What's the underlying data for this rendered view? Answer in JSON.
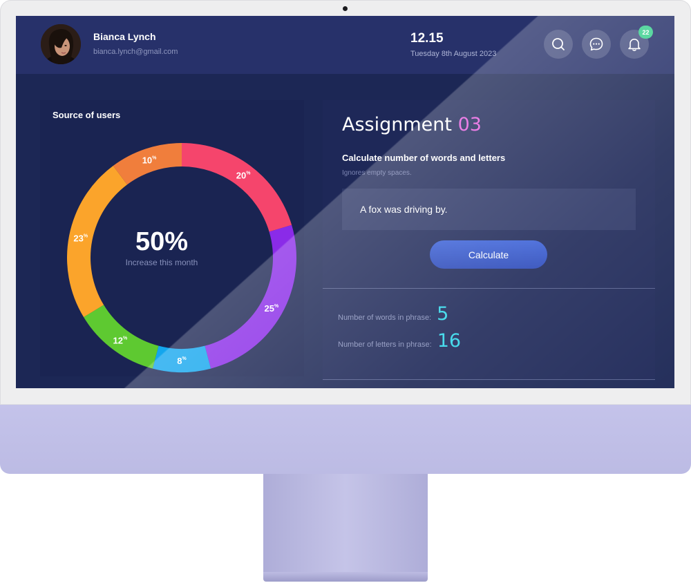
{
  "user": {
    "name": "Bianca Lynch",
    "email": "bianca.lynch@gmail.com"
  },
  "clock": {
    "time": "12.15",
    "date": "Tuesday 8th August 2023"
  },
  "notifications": {
    "count": "22"
  },
  "source_panel": {
    "title": "Source of users",
    "center_value": "50%",
    "center_label": "Increase this month"
  },
  "chart_data": {
    "type": "pie",
    "title": "Source of users",
    "slices": [
      {
        "value": 20,
        "label": "20",
        "color": "#f5456c"
      },
      {
        "value": 25,
        "label": "25",
        "color": "#8a2be8"
      },
      {
        "value": 8,
        "label": "8",
        "color": "#13a6ee"
      },
      {
        "value": 12,
        "label": "12",
        "color": "#5ec931"
      },
      {
        "value": 23,
        "label": "23",
        "color": "#fba42b"
      },
      {
        "value": 10,
        "label": "10",
        "color": "#f07e3c"
      }
    ],
    "percent_sign": "%"
  },
  "assignment": {
    "title": "Assignment",
    "number": "03",
    "subtitle": "Calculate number of words and letters",
    "hint": "Ignores empty spaces.",
    "phrase": "A fox was driving by.",
    "button_label": "Calculate"
  },
  "results": {
    "words_label": "Number of words in phrase:",
    "words_value": "5",
    "letters_label": "Number of letters in phrase:",
    "letters_value": "16"
  },
  "icons": [
    "search-icon",
    "chat-icon",
    "bell-icon"
  ]
}
